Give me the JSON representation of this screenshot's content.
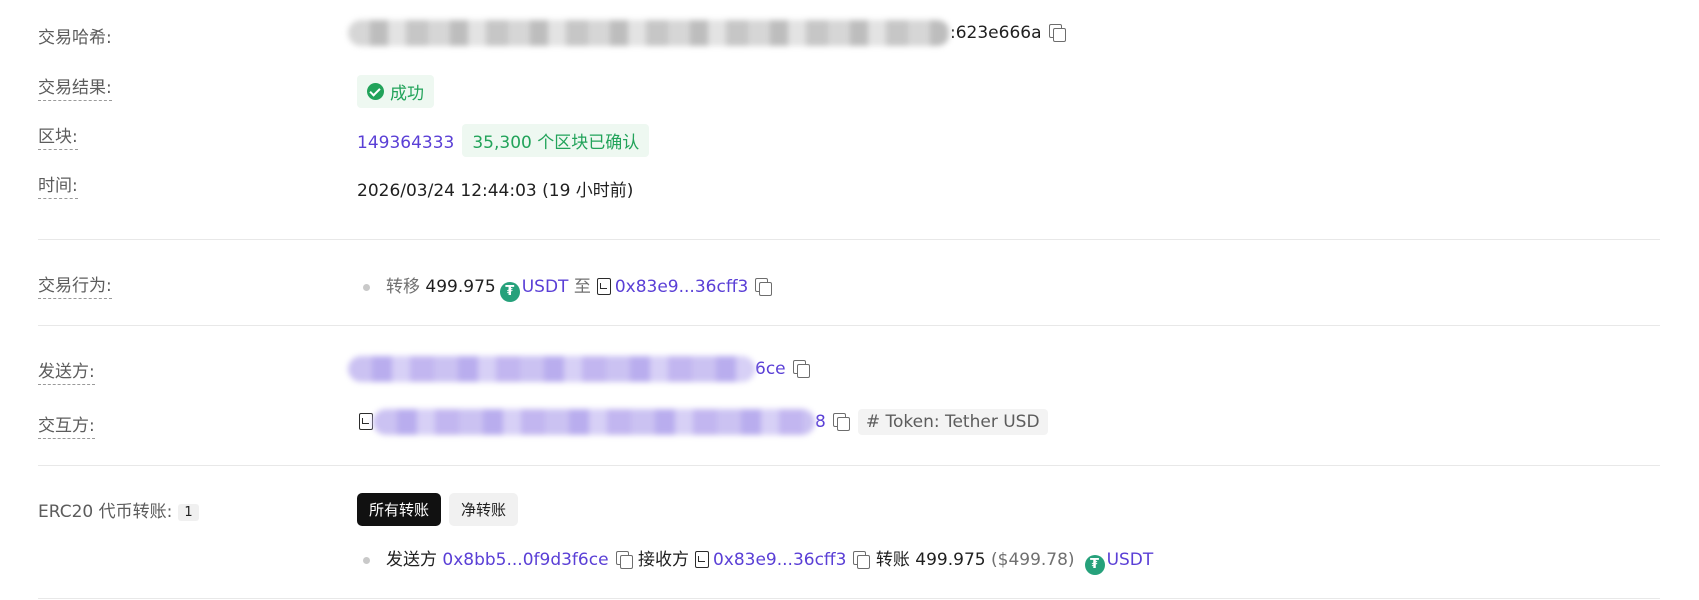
{
  "tx_hash": {
    "label": "交易哈希:",
    "suffix": ":623e666a"
  },
  "result": {
    "label": "交易结果:",
    "status": "成功"
  },
  "block": {
    "label": "区块:",
    "number": "149364333",
    "confirmations": "35,300 个区块已确认"
  },
  "time": {
    "label": "时间:",
    "value": "2026/03/24 12:44:03 (19 小时前)"
  },
  "action": {
    "label": "交易行为:",
    "verb": "转移",
    "amount": "499.975",
    "token": "USDT",
    "to_word": "至",
    "to_address": "0x83e9...36cff3"
  },
  "from": {
    "label": "发送方:",
    "suffix": "6ce"
  },
  "interact": {
    "label": "交互方:",
    "suffix": "8",
    "tag": "# Token: Tether USD"
  },
  "erc20": {
    "label": "ERC20 代币转账:",
    "count": "1",
    "tabs": [
      "所有转账",
      "净转账"
    ],
    "transfer": {
      "from_word": "发送方",
      "from_address": "0x8bb5...0f9d3f6ce",
      "to_word": "接收方",
      "to_address": "0x83e9...36cff3",
      "amount_word": "转账",
      "amount": "499.975",
      "usd": "($499.78)",
      "token": "USDT"
    }
  },
  "icons": {
    "copy": "copy-icon",
    "success": "check-circle-icon",
    "tether": "tether-icon",
    "contract": "contract-icon"
  },
  "colors": {
    "link": "#5a3fd6",
    "success": "#22a35a",
    "tether": "#26a17b"
  }
}
